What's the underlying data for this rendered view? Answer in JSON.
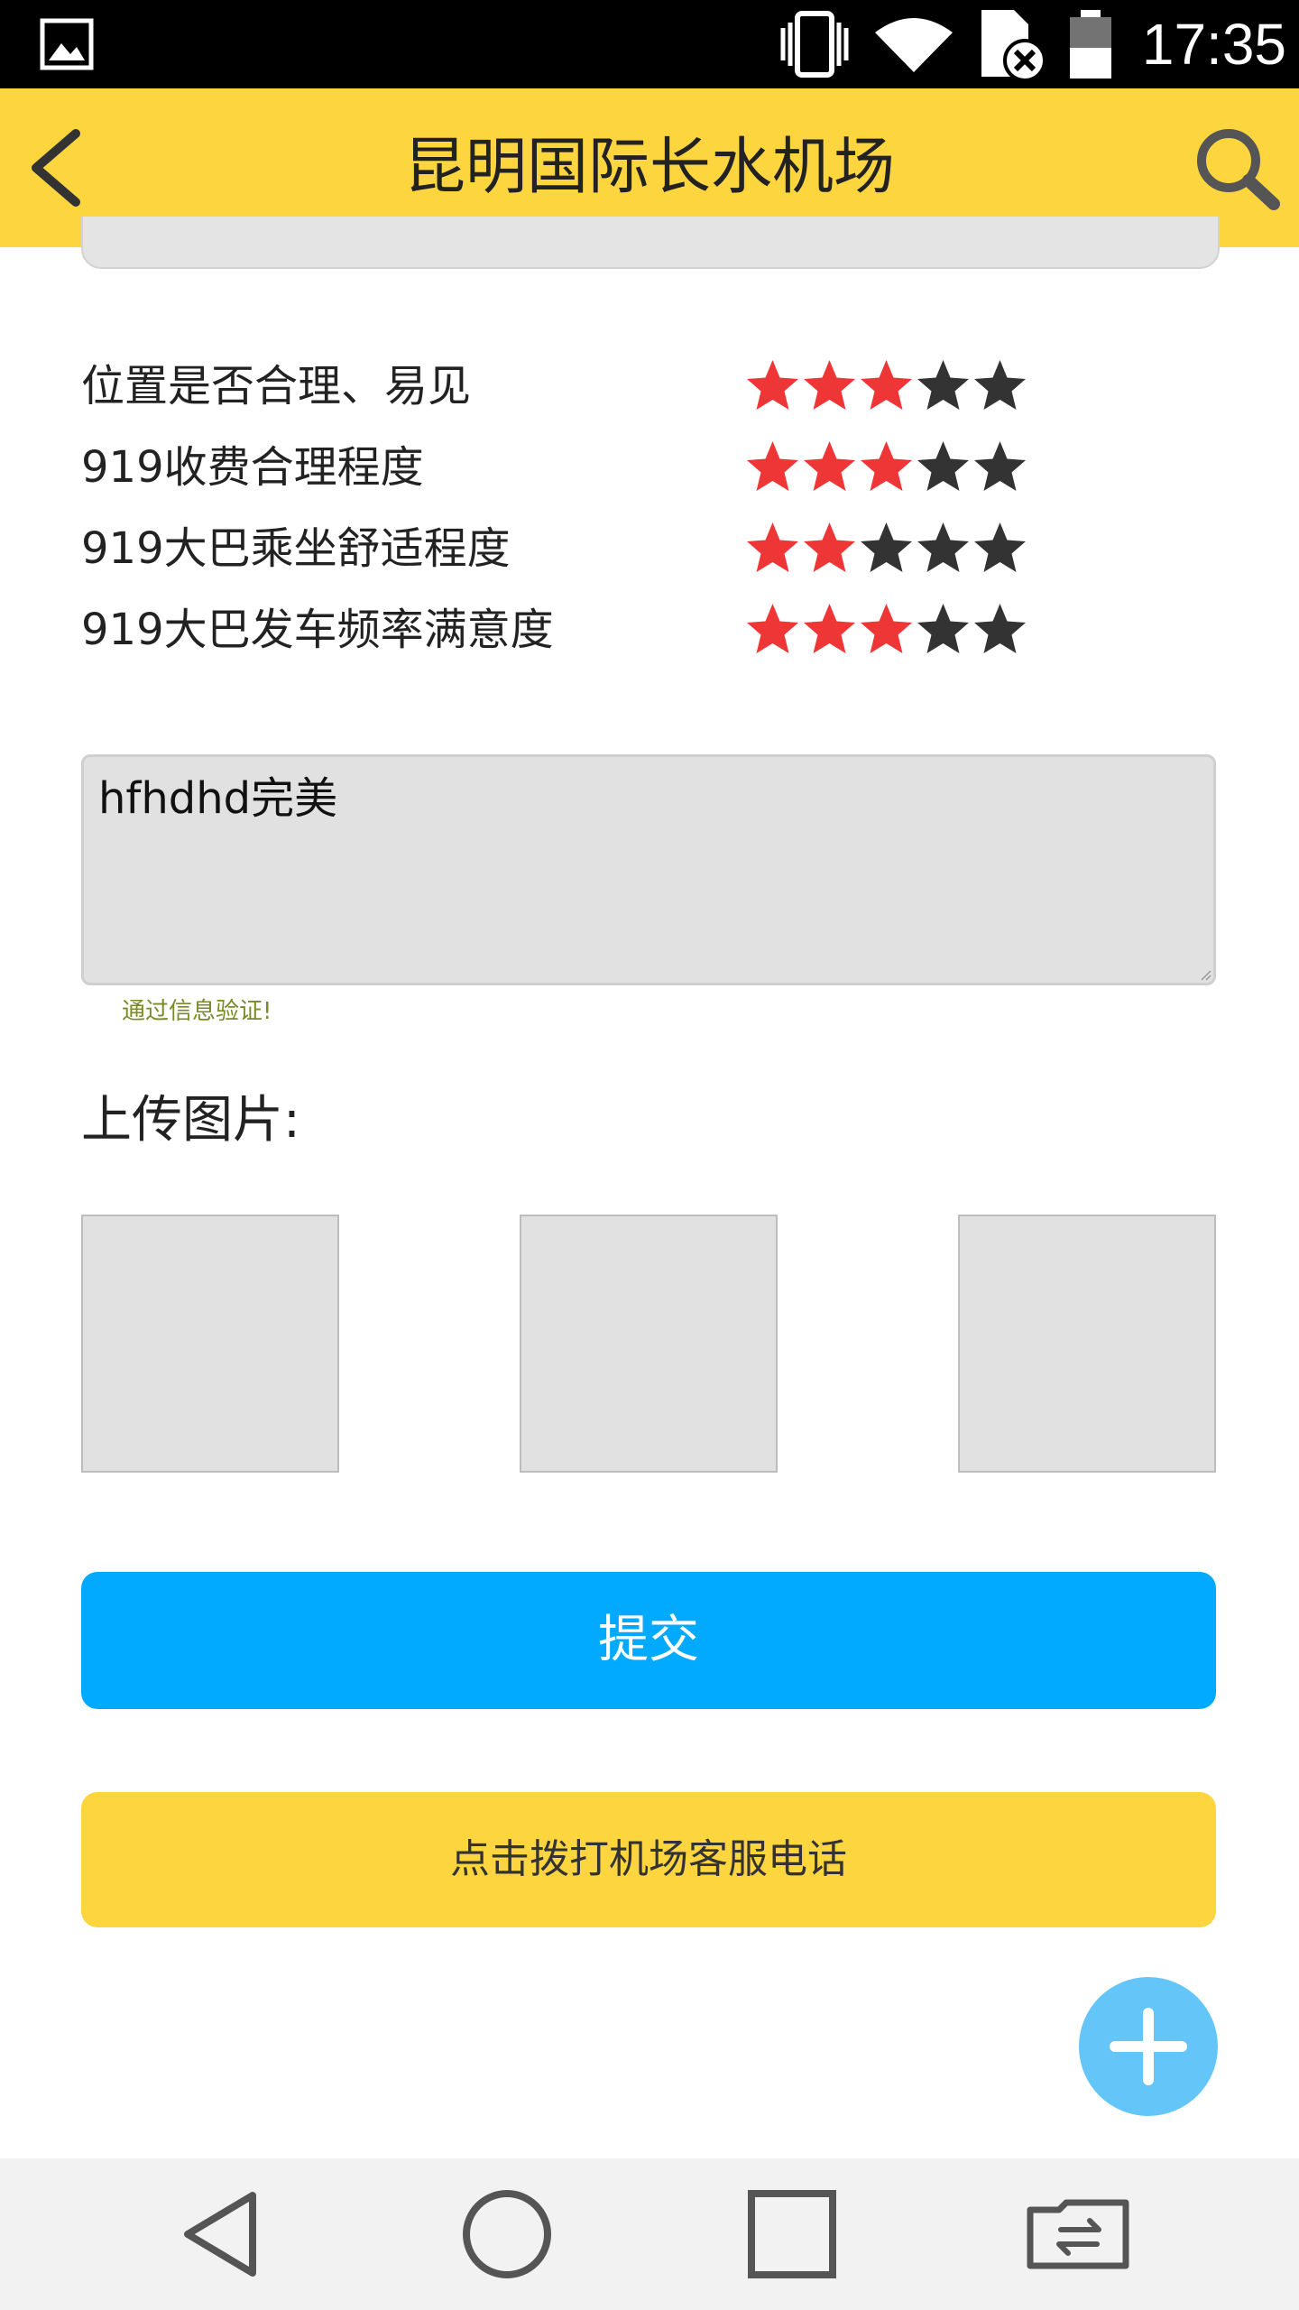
{
  "status_bar": {
    "time": "17:35",
    "icons": [
      "image-notification-icon",
      "vibrate-icon",
      "wifi-icon",
      "sim-no-service-icon",
      "battery-icon"
    ]
  },
  "header": {
    "title": "昆明国际长水机场",
    "back_icon": "back-arrow-icon",
    "search_icon": "search-icon",
    "background": "#FDD63F"
  },
  "ratings": [
    {
      "label": "位置是否合理、易见",
      "stars": 3,
      "max": 5
    },
    {
      "label": "919收费合理程度",
      "stars": 3,
      "max": 5
    },
    {
      "label": "919大巴乘坐舒适程度",
      "stars": 2,
      "max": 5
    },
    {
      "label": "919大巴发车频率满意度",
      "stars": 3,
      "max": 5
    }
  ],
  "star_colors": {
    "filled": "#EE3636",
    "empty": "#333333"
  },
  "comment": {
    "value": "hfhdhd完美",
    "verify_message": "通过信息验证!"
  },
  "upload": {
    "label": "上传图片:",
    "slots": 3
  },
  "buttons": {
    "submit_label": "提交",
    "submit_color": "#01AAFF",
    "call_label": "点击拨打机场客服电话",
    "call_color": "#FDD63F",
    "fab_icon": "plus-icon"
  },
  "nav_bar": {
    "icons": [
      "nav-back-icon",
      "nav-home-icon",
      "nav-recents-icon",
      "nav-switch-icon"
    ]
  }
}
